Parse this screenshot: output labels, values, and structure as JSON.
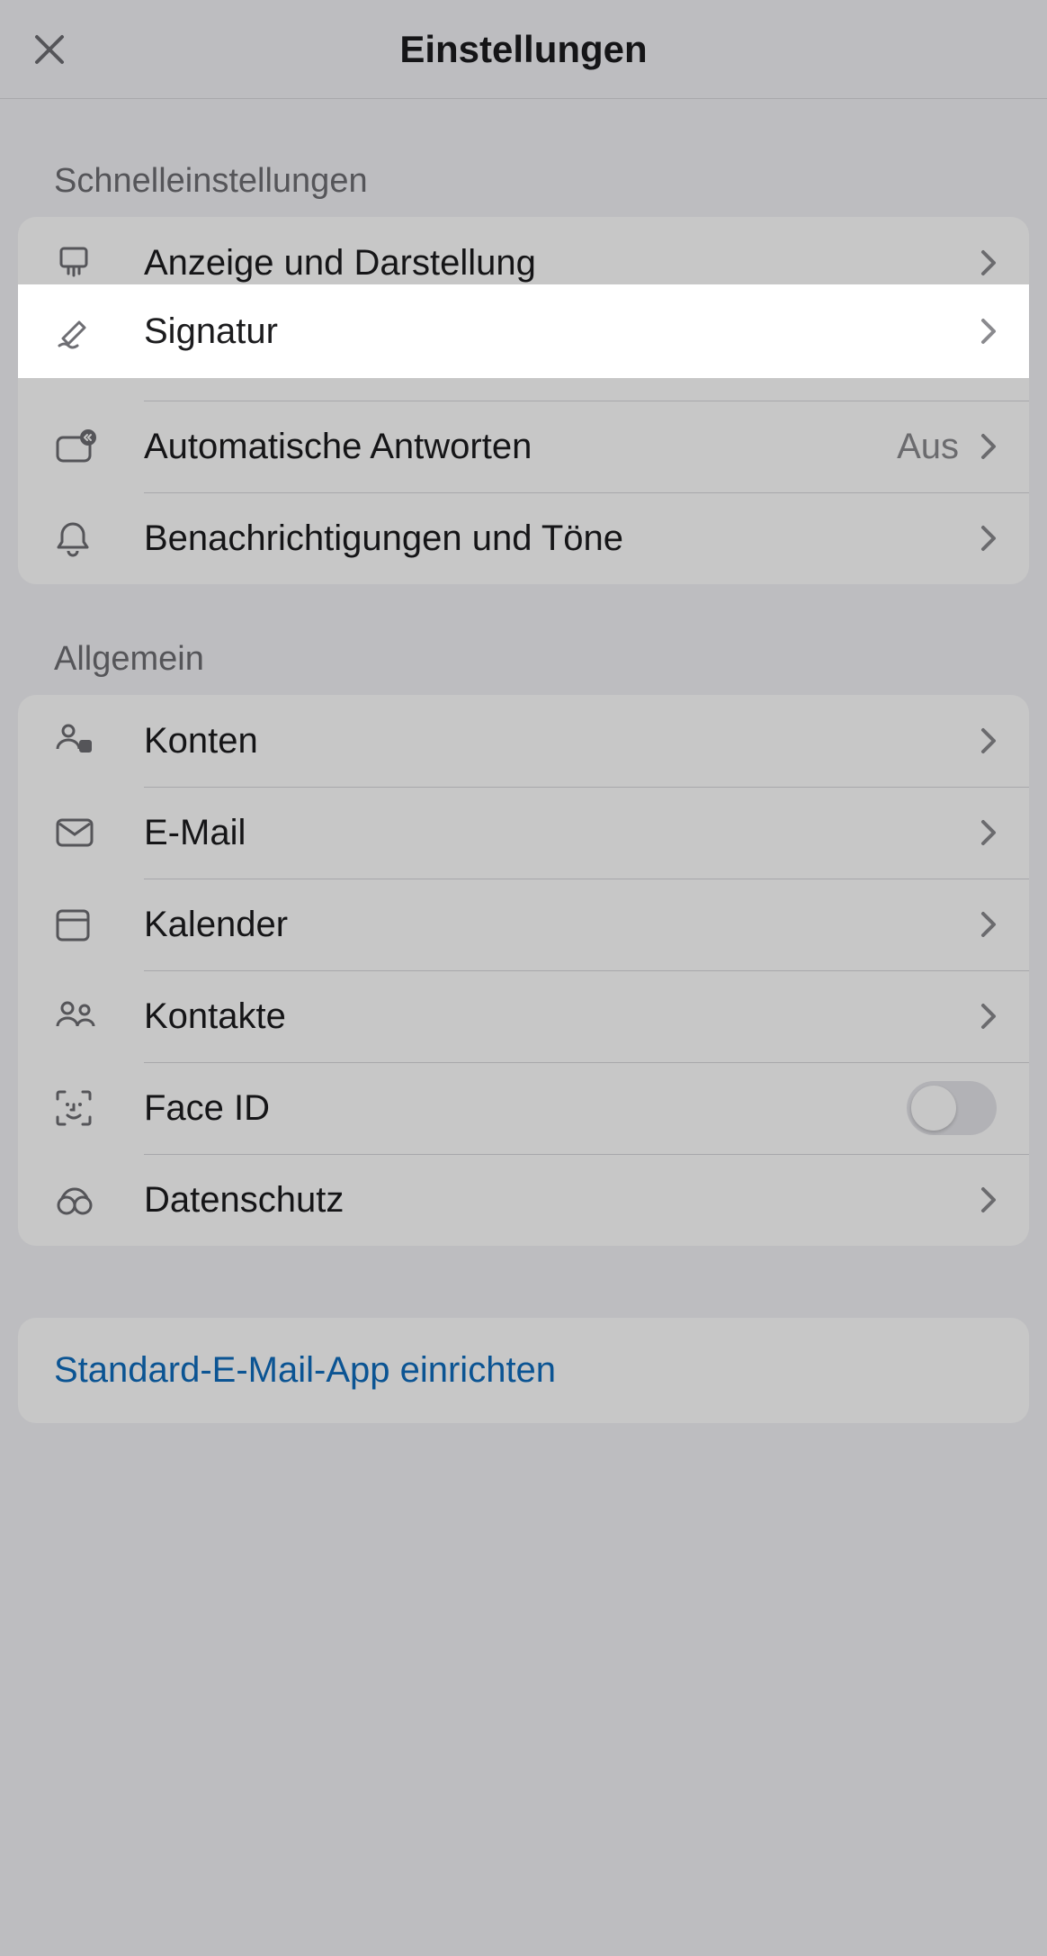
{
  "header": {
    "title": "Einstellungen"
  },
  "sections": {
    "quick": {
      "label": "Schnelleinstellungen",
      "items": {
        "appearance": {
          "label": "Anzeige und Darstellung"
        },
        "signature": {
          "label": "Signatur"
        },
        "autoreply": {
          "label": "Automatische Antworten",
          "value": "Aus"
        },
        "notifications": {
          "label": "Benachrichtigungen und Töne"
        }
      }
    },
    "general": {
      "label": "Allgemein",
      "items": {
        "accounts": {
          "label": "Konten"
        },
        "email": {
          "label": "E-Mail"
        },
        "calendar": {
          "label": "Kalender"
        },
        "contacts": {
          "label": "Kontakte"
        },
        "faceid": {
          "label": "Face ID",
          "toggle": false
        },
        "privacy": {
          "label": "Datenschutz"
        }
      }
    }
  },
  "link": {
    "default_mail_app": "Standard-E-Mail-App einrichten"
  },
  "icons": {
    "close": "close-icon",
    "chevron": "chevron-right-icon"
  }
}
